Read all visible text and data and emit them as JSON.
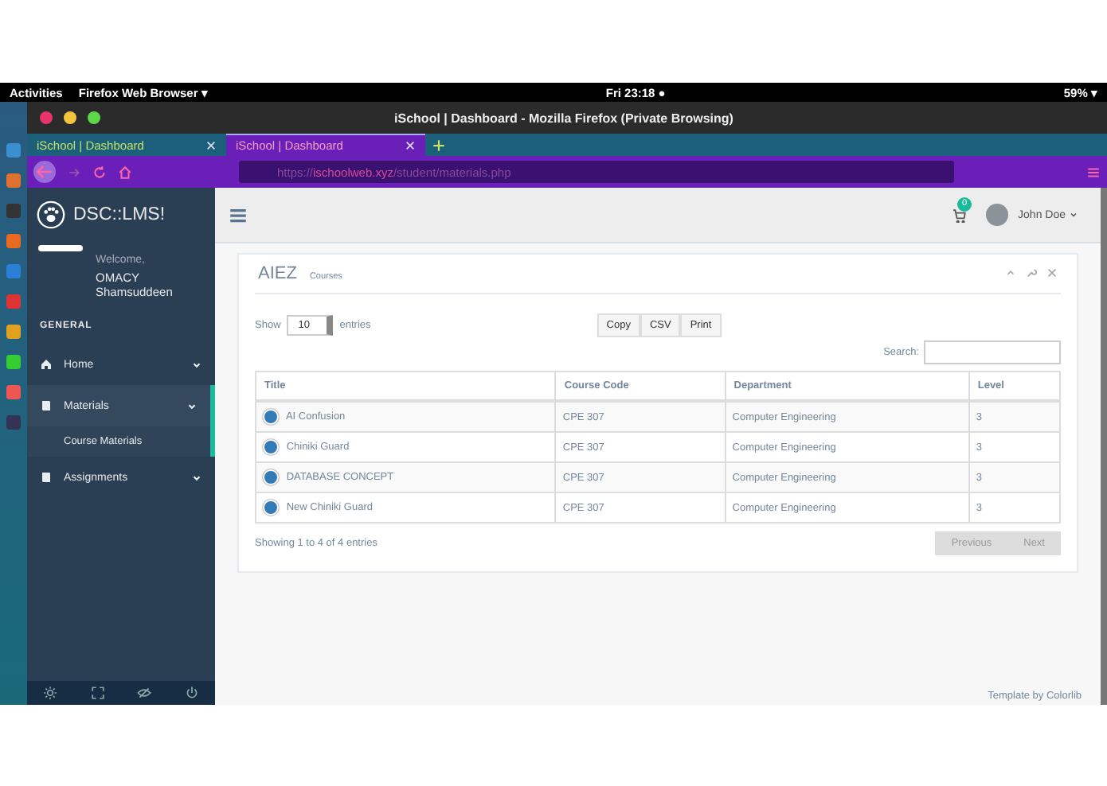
{
  "topbar": {
    "activities": "Activities",
    "app": "Firefox Web Browser ▾",
    "clock": "Fri 23:18 ●",
    "battery": "59% ▾"
  },
  "window": {
    "title": "iSchool | Dashboard - Mozilla Firefox (Private Browsing)"
  },
  "tabs": [
    {
      "label": "iSchool | Dashboard",
      "selected": false
    },
    {
      "label": "iSchool | Dashboard",
      "selected": true
    }
  ],
  "url": {
    "prefix": "https://",
    "host": "ischoolweb.xyz",
    "path": "/student/materials.php"
  },
  "sidebar": {
    "brand": "DSC::LMS!",
    "welcome": "Welcome,",
    "user": "OMACY Shamsuddeen",
    "section": "GENERAL",
    "items": [
      {
        "label": "Home",
        "kind": "home",
        "expanded": false
      },
      {
        "label": "Materials",
        "kind": "book",
        "expanded": true,
        "children": [
          {
            "label": "Course Materials",
            "selected": true
          }
        ]
      },
      {
        "label": "Assignments",
        "kind": "book",
        "expanded": false
      }
    ]
  },
  "header": {
    "cart_count": "0",
    "user": "John Doe"
  },
  "panel": {
    "title": "AIEZ",
    "subtitle": "Courses",
    "show": "Show",
    "page_size": "10",
    "entries": "entries",
    "buttons": [
      "Copy",
      "CSV",
      "Print"
    ],
    "search_label": "Search:",
    "columns": [
      "Title",
      "Course Code",
      "Department",
      "Level"
    ],
    "rows": [
      [
        "AI Confusion",
        "CPE 307",
        "Computer Engineering",
        "3"
      ],
      [
        "Chiniki Guard",
        "CPE 307",
        "Computer Engineering",
        "3"
      ],
      [
        "DATABASE CONCEPT",
        "CPE 307",
        "Computer Engineering",
        "3"
      ],
      [
        "New Chiniki Guard",
        "CPE 307",
        "Computer Engineering",
        "3"
      ]
    ],
    "info": "Showing 1 to 4 of 4 entries",
    "pager": [
      "Previous",
      "Next"
    ]
  },
  "footer": "Template by Colorlib"
}
